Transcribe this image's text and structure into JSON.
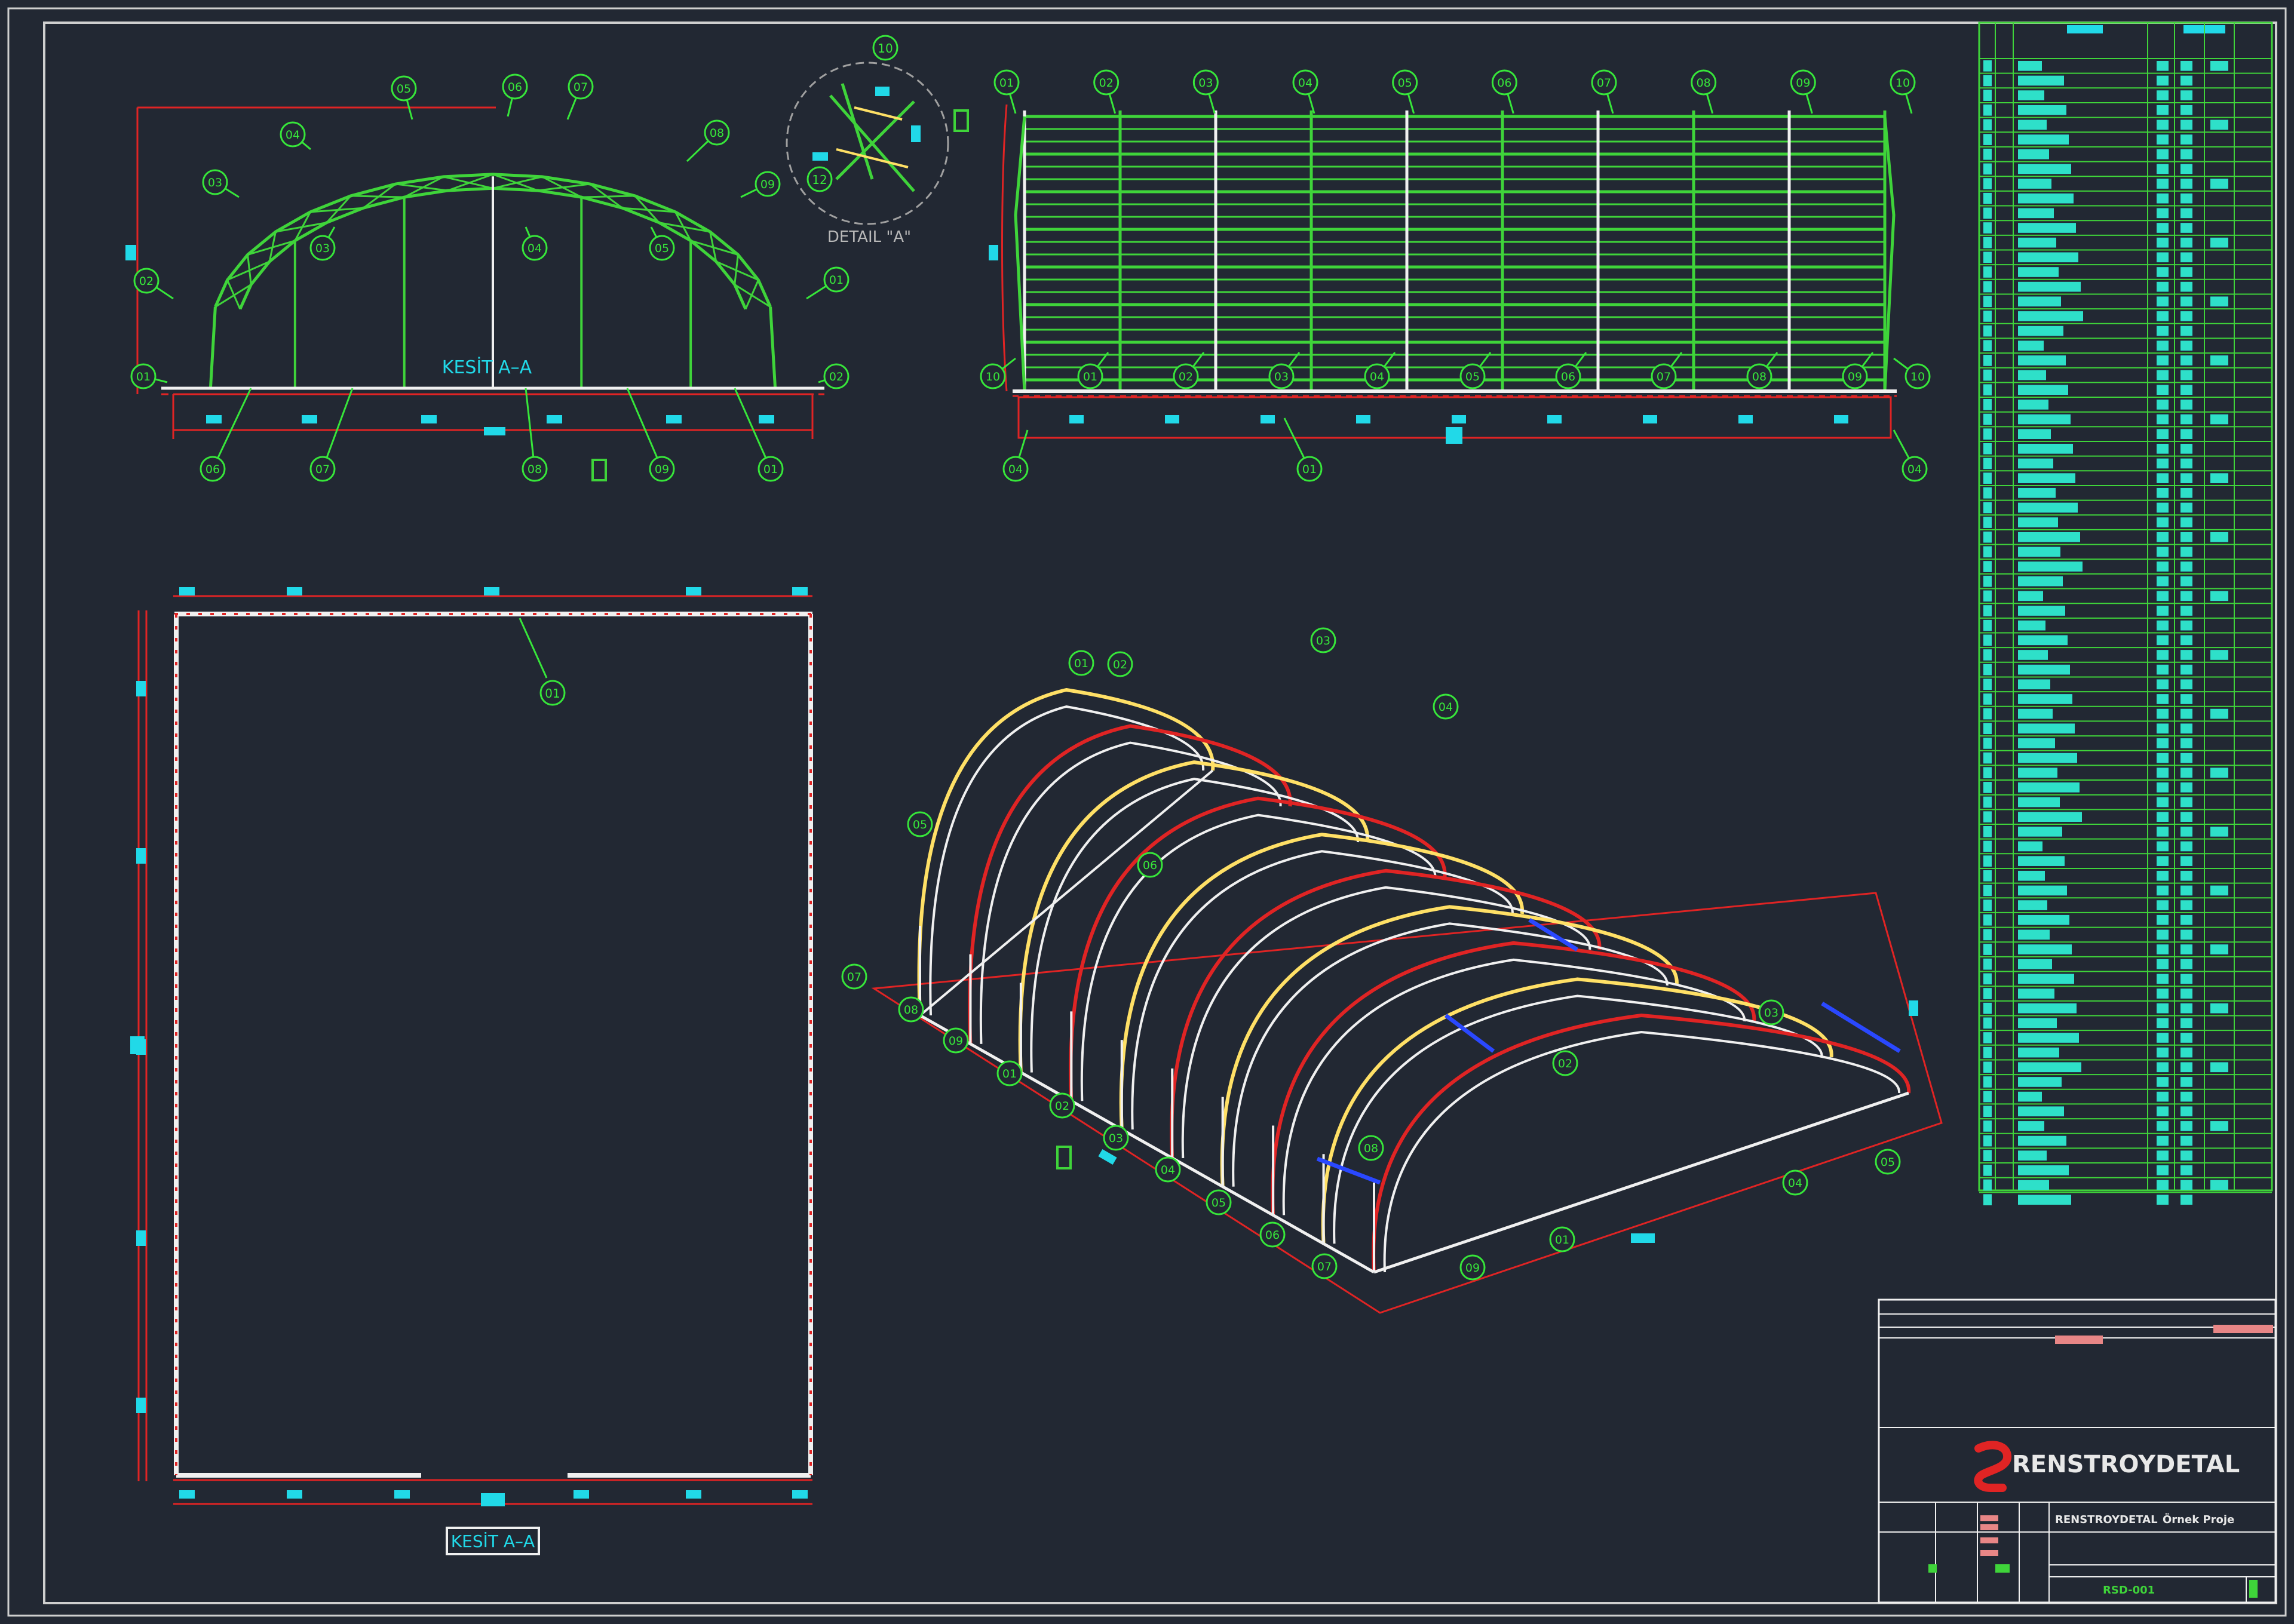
{
  "section_label": "KESİT A–A",
  "plan_label": "KESİT A–A",
  "detail_label": "DETAIL \"A\"",
  "detail_callouts": [
    "10",
    "12"
  ],
  "section_callouts": [
    "01",
    "02",
    "03",
    "04",
    "05",
    "06",
    "07",
    "08",
    "09"
  ],
  "elevation_callouts": [
    "01",
    "02",
    "03",
    "04",
    "05",
    "06",
    "07",
    "08",
    "09",
    "10"
  ],
  "iso_callouts": [
    "01",
    "02",
    "03",
    "04",
    "05",
    "06",
    "07",
    "08",
    "09"
  ],
  "title_block": {
    "company": "RENSTROYDETAL",
    "project_line": "RENSTROYDETAL",
    "project_sub": "Örnek Proje",
    "drawing_no": "RSD-001"
  },
  "colors": {
    "background": "#222833",
    "frame": "#d0d0d0",
    "callout": "#37e63a",
    "steel_green": "#3fd43a",
    "steel_red": "#e02424",
    "steel_yellow": "#ffe066",
    "white": "#f0f0f0",
    "cyan": "#21d9e8",
    "blue": "#2a48ff",
    "table_fill": "#2ee0c9"
  },
  "icons": {
    "logo": "renstroydetal-logo"
  }
}
